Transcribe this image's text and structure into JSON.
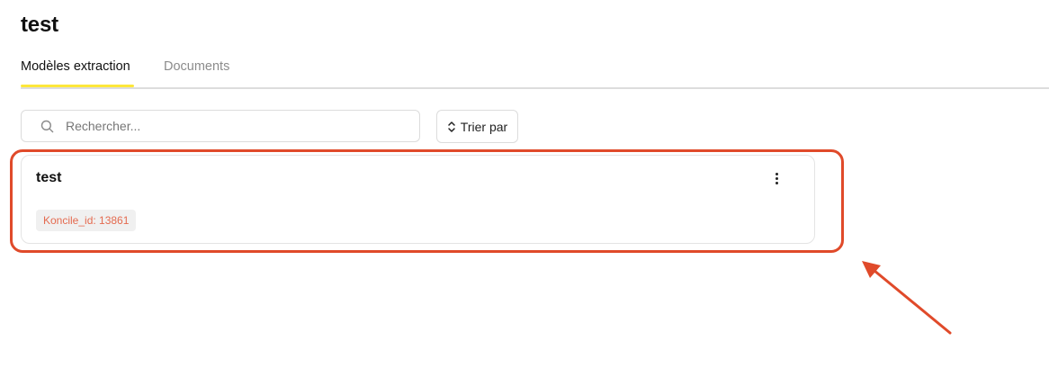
{
  "page": {
    "title": "test"
  },
  "tabs": [
    {
      "label": "Modèles extraction",
      "active": true
    },
    {
      "label": "Documents",
      "active": false
    }
  ],
  "toolbar": {
    "search_placeholder": "Rechercher...",
    "search_value": "",
    "search_icon": "search-icon",
    "sort_label": "Trier par",
    "sort_icon": "sort-arrows-icon"
  },
  "models": [
    {
      "name": "test",
      "badge": "Koncile_id: 13861",
      "menu_icon": "vertical-dots-icon"
    }
  ],
  "colors": {
    "active_tab_underline": "#fde73a",
    "highlight_annotation": "#e04a2a",
    "badge_text": "#e46a4f",
    "badge_background": "#f0f0f0"
  }
}
